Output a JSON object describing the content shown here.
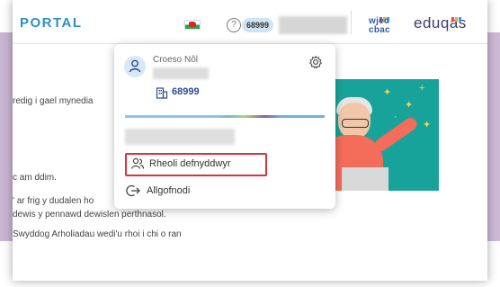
{
  "header": {
    "portal_label": "PORTAL",
    "centre_badge": "68999",
    "help_symbol": "?",
    "logos": {
      "wjec_line1": "wjec",
      "wjec_line2": "cbac",
      "eduqas": "eduqas"
    }
  },
  "page": {
    "lines": [
      "redig i gael mynedia",
      "c am ddim.",
      "' ar frig y dudalen ho",
      "dewis y pennawd dewislen perthnasol.",
      "Swyddog Arholiadau wedi'u rhoi i chi o ran"
    ]
  },
  "dropdown": {
    "welcome": "Croeso Nôl",
    "centre_number": "68999",
    "menu": [
      {
        "label": "Rheoli defnyddwyr",
        "icon": "users-icon",
        "highlighted": true
      },
      {
        "label": "Allgofnodi",
        "icon": "logout-icon",
        "highlighted": false
      }
    ]
  },
  "colors": {
    "portal_blue": "#2e8fc9",
    "highlight_red": "#d8343c",
    "illustration_teal": "#17a39a",
    "purple_band": "#c2aecd"
  }
}
